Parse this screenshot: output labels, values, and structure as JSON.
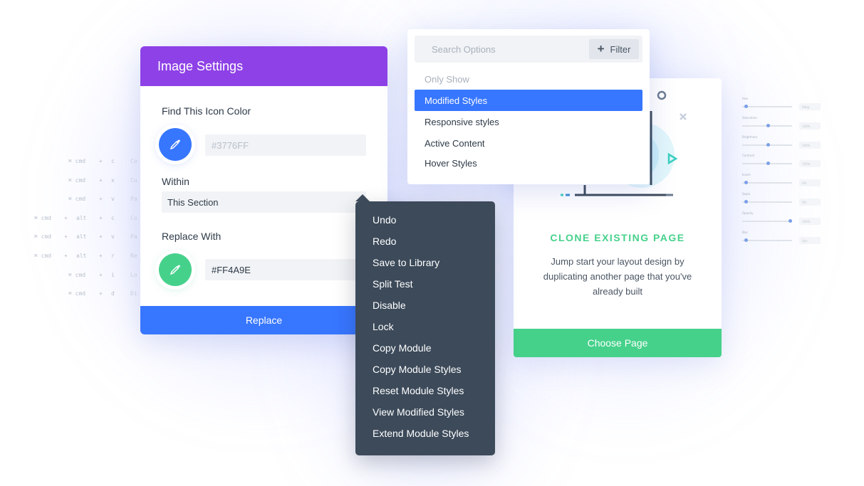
{
  "shortcuts": [
    {
      "mod": "⌘ cmd",
      "alt": "",
      "key": "c",
      "desc": "Co"
    },
    {
      "mod": "⌘ cmd",
      "alt": "",
      "key": "x",
      "desc": "Cu"
    },
    {
      "mod": "⌘ cmd",
      "alt": "",
      "key": "v",
      "desc": "Pa"
    },
    {
      "mod": "⌘ cmd",
      "alt": "alt",
      "key": "c",
      "desc": "Co"
    },
    {
      "mod": "⌘ cmd",
      "alt": "alt",
      "key": "v",
      "desc": "Pa"
    },
    {
      "mod": "⌘ cmd",
      "alt": "alt",
      "key": "r",
      "desc": "Re"
    },
    {
      "mod": "⌘ cmd",
      "alt": "",
      "key": "i",
      "desc": "Lo"
    },
    {
      "mod": "⌘ cmd",
      "alt": "",
      "key": "d",
      "desc": "Di"
    }
  ],
  "sliders": [
    {
      "label": "Hue",
      "value": 0.05,
      "box": "0deg"
    },
    {
      "label": "Saturation",
      "value": 0.5,
      "box": "100%"
    },
    {
      "label": "Brightness",
      "value": 0.5,
      "box": "100%"
    },
    {
      "label": "Contrast",
      "value": 0.5,
      "box": "100%"
    },
    {
      "label": "Invert",
      "value": 0.05,
      "box": "0%"
    },
    {
      "label": "Sepia",
      "value": 0.05,
      "box": "0%"
    },
    {
      "label": "Opacity",
      "value": 0.95,
      "box": "100%"
    },
    {
      "label": "Blur",
      "value": 0.05,
      "box": "0px"
    }
  ],
  "image_settings": {
    "title": "Image Settings",
    "find_label": "Find This Icon Color",
    "find_placeholder": "#3776FF",
    "within_label": "Within",
    "within_value": "This Section",
    "replace_label": "Replace With",
    "replace_value": "#FF4A9E",
    "replace_button": "Replace"
  },
  "search_options": {
    "placeholder": "Search Options",
    "filter_label": "Filter",
    "header": "Only Show",
    "options": [
      "Modified Styles",
      "Responsive styles",
      "Active Content",
      "Hover Styles"
    ],
    "selected_index": 0
  },
  "clone_card": {
    "title": "CLONE EXISTING PAGE",
    "description": "Jump start your layout design by duplicating another page that you've already built",
    "button": "Choose Page"
  },
  "context_menu": {
    "items": [
      "Undo",
      "Redo",
      "Save to Library",
      "Split Test",
      "Disable",
      "Lock",
      "Copy Module",
      "Copy Module Styles",
      "Reset Module Styles",
      "View Modified Styles",
      "Extend Module Styles"
    ]
  },
  "colors": {
    "purple": "#8e41e6",
    "blue": "#3776ff",
    "green": "#46d18b",
    "menu_bg": "#3c4a5a"
  }
}
